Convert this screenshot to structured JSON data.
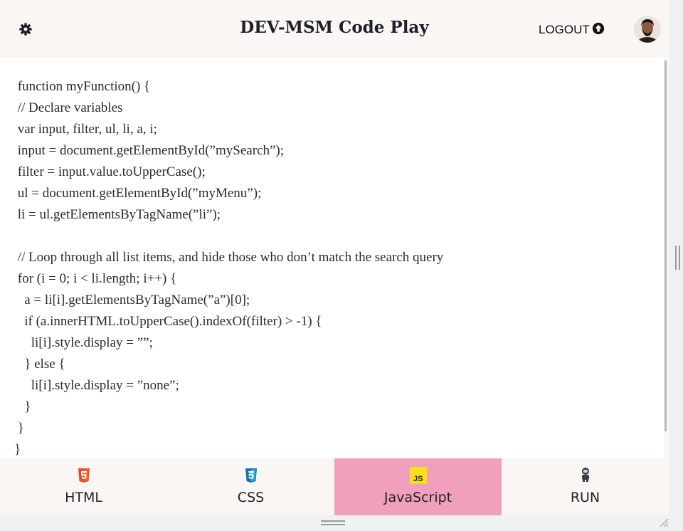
{
  "header": {
    "title": "DEV-MSM Code Play",
    "logout_label": "LOGOUT",
    "settings_icon": "gear-icon",
    "logout_icon": "arrow-up-circle-icon",
    "avatar": "user-avatar"
  },
  "editor": {
    "language": "JavaScript",
    "code": " function myFunction() {\n // Declare variables\n var input, filter, ul, li, a, i;\n input = document.getElementById(”mySearch”);\n filter = input.value.toUpperCase();\n ul = document.getElementById(”myMenu”);\n li = ul.getElementsByTagName(”li”);\n\n // Loop through all list items, and hide those who don’t match the search query\n for (i = 0; i < li.length; i++) {\n   a = li[i].getElementsByTagName(”a”)[0];\n   if (a.innerHTML.toUpperCase().indexOf(filter) > -1) {\n     li[i].style.display = ””;\n   } else {\n     li[i].style.display = ”none”;\n   }\n }\n}"
  },
  "tabs": [
    {
      "label": "HTML",
      "icon": "html5-icon",
      "color": "#e44d26",
      "active": false
    },
    {
      "label": "CSS",
      "icon": "css3-icon",
      "color": "#2965f1",
      "active": false
    },
    {
      "label": "JavaScript",
      "icon": "js-icon",
      "color": "#f7df1e",
      "active": true
    },
    {
      "label": "RUN",
      "icon": "astronaut-icon",
      "color": "#555555",
      "active": false
    }
  ],
  "colors": {
    "header_bg": "#faf6f3",
    "active_tab": "#f0a0bd",
    "text": "#2a2a35"
  }
}
